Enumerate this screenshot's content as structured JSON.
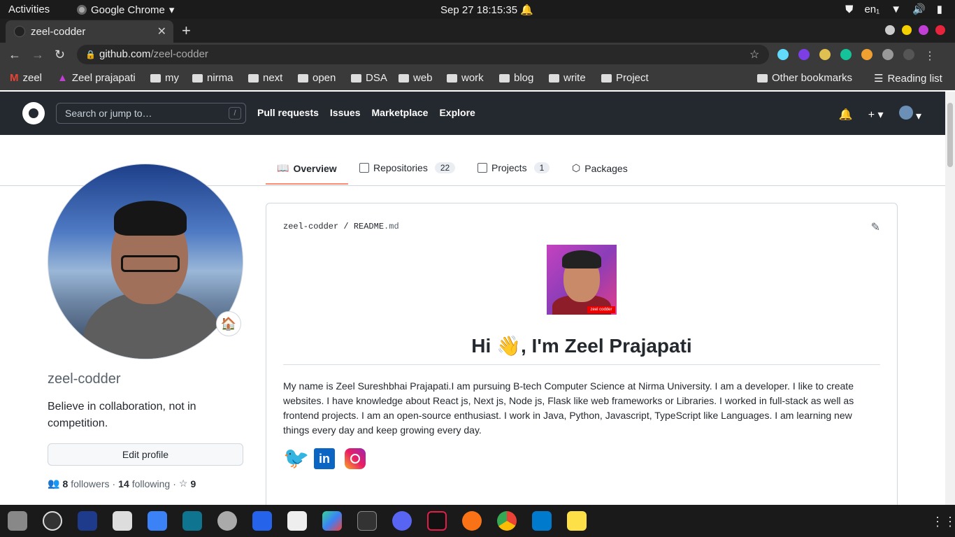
{
  "system": {
    "activities": "Activities",
    "app": "Google Chrome",
    "clock": "Sep 27  18:15:35",
    "lang": "en₁"
  },
  "browser": {
    "tab_title": "zeel-codder",
    "url_host": "github.com",
    "url_path": "/zeel-codder",
    "bookmarks": [
      "zeel",
      "Zeel prajapati",
      "my",
      "nirma",
      "next",
      "open",
      "DSA",
      "web",
      "work",
      "blog",
      "write",
      "Project"
    ],
    "other_bookmarks": "Other bookmarks",
    "reading_list": "Reading list"
  },
  "github": {
    "search_placeholder": "Search or jump to…",
    "search_key": "/",
    "nav": [
      "Pull requests",
      "Issues",
      "Marketplace",
      "Explore"
    ]
  },
  "profile_tabs": {
    "overview": "Overview",
    "repositories": "Repositories",
    "repositories_count": "22",
    "projects": "Projects",
    "projects_count": "1",
    "packages": "Packages"
  },
  "profile": {
    "username": "zeel-codder",
    "bio": "Believe in collaboration, not in competition.",
    "edit_button": "Edit profile",
    "followers_count": "8",
    "followers_label": "followers",
    "following_count": "14",
    "following_label": "following",
    "stars_count": "9",
    "status_emoji": "🏠"
  },
  "readme": {
    "owner": "zeel-codder",
    "file": "README",
    "ext": ".md",
    "image_tag": "zeel codder",
    "heading": "Hi 👋, I'm Zeel Prajapati",
    "paragraph": "My name is Zeel Sureshbhai Prajapati.I am pursuing B-tech Computer Science at Nirma University. I am a developer. I like to create websites. I have knowledge about React js, Next js, Node js, Flask like web frameworks or Libraries. I worked in full-stack as well as frontend projects. I am an open-source enthusiast. I work in Java, Python, Javascript, TypeScript like Languages. I am learning new things every day and keep growing every day.",
    "socials": [
      "twitter-icon",
      "linkedin-icon",
      "instagram-icon"
    ]
  },
  "colors": {
    "gh_header": "#24292f",
    "tab_underline": "#fd8c73"
  }
}
